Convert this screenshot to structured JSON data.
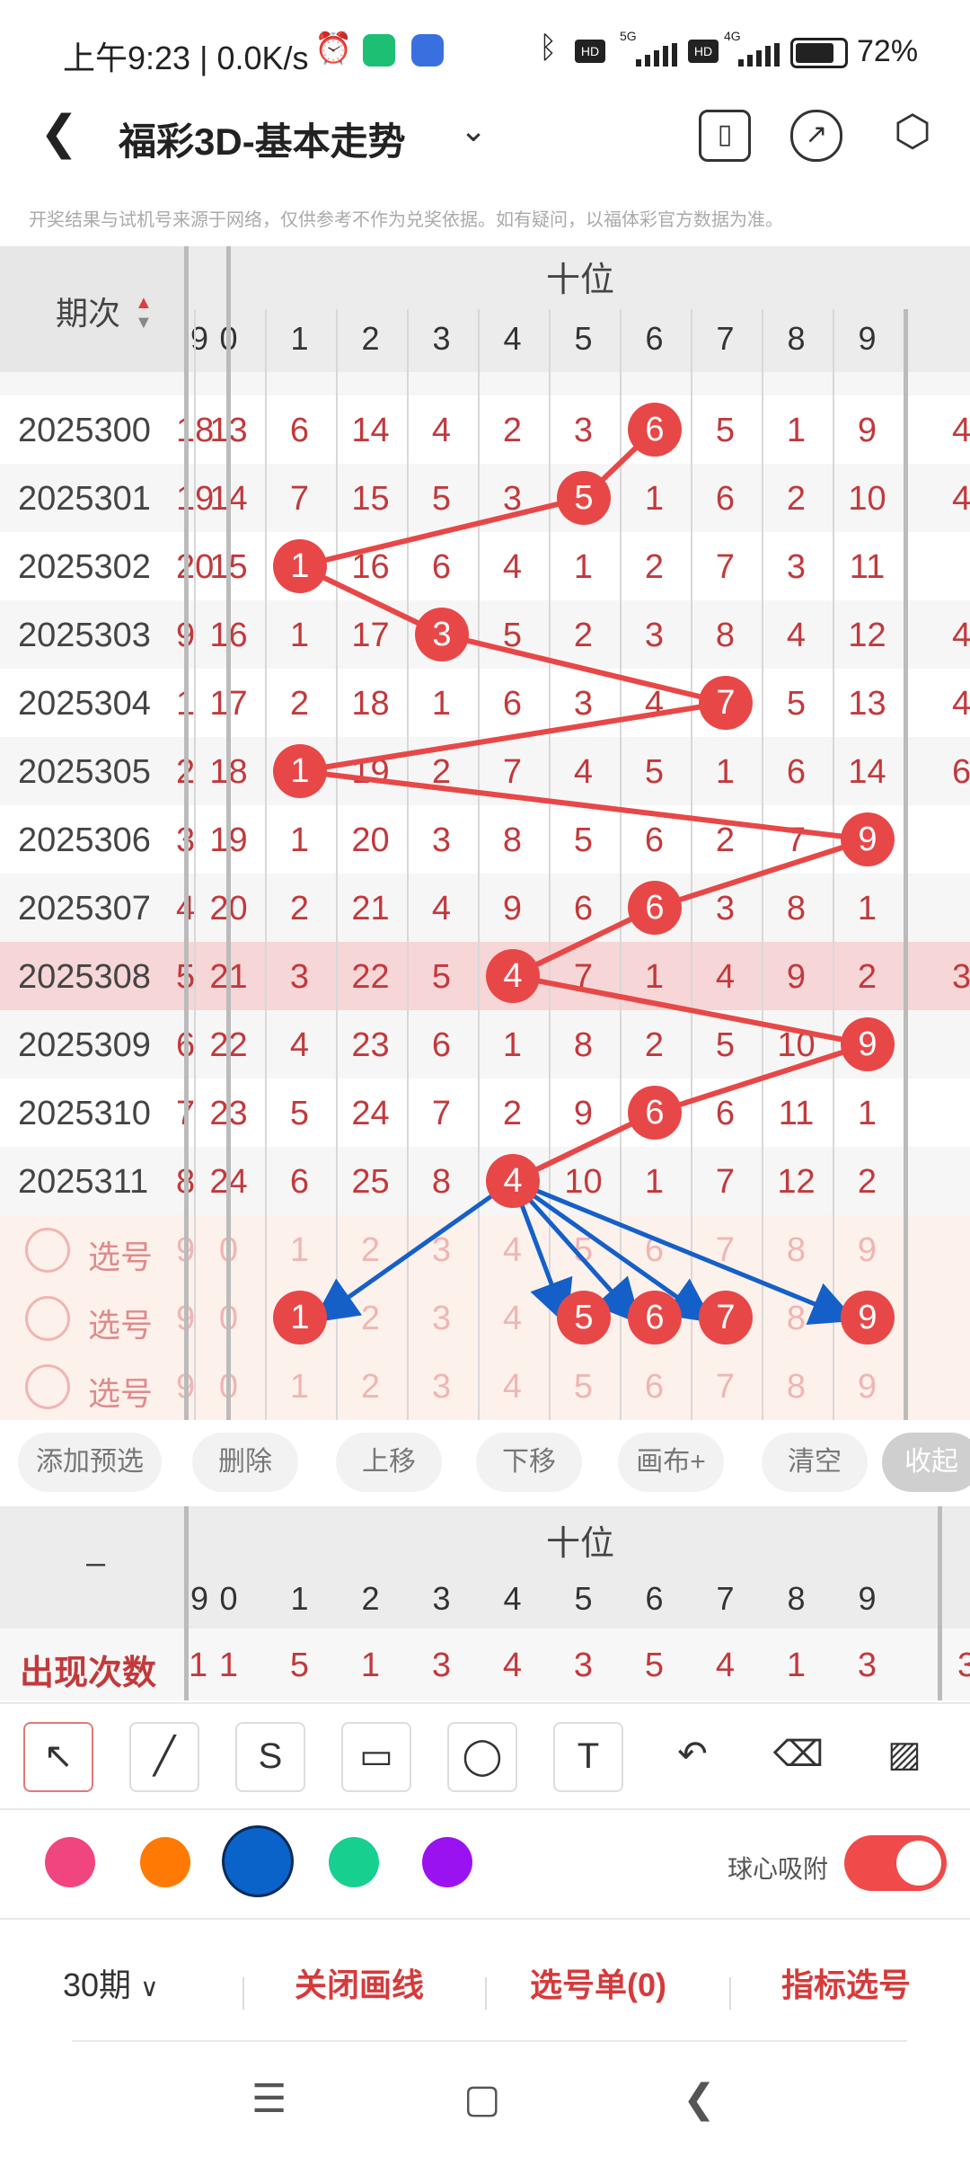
{
  "status_bar": {
    "time": "上午9:23",
    "speed": "| 0.0K/s",
    "icons": [
      "alarm-icon",
      "shield-app-icon",
      "baidu-app-icon",
      "bluetooth-icon",
      "hd-icon",
      "signal-5g-icon",
      "hd-icon",
      "signal-4g-icon",
      "battery-icon"
    ],
    "net_5g": "5G",
    "net_4g": "4G",
    "hd": "HD",
    "battery": "72%"
  },
  "header": {
    "title": "福彩3D-基本走势"
  },
  "disclaimer": "开奖结果与试机号来源于网络，仅供参考不作为兑奖依据。如有疑问，以福体彩官方数据为准。",
  "table": {
    "period_header": "期次",
    "section_header": "十位",
    "digit_headers": [
      "0",
      "1",
      "2",
      "3",
      "4",
      "5",
      "6",
      "7",
      "8",
      "9"
    ],
    "left_partial_header": "9",
    "rows": [
      {
        "period": "2025300",
        "left": "18",
        "cells": [
          "13",
          "6",
          "14",
          "4",
          "2",
          "3",
          "6",
          "5",
          "1",
          "9"
        ],
        "right": "4",
        "hit": 6
      },
      {
        "period": "2025301",
        "left": "19",
        "cells": [
          "14",
          "7",
          "15",
          "5",
          "3",
          "5",
          "1",
          "6",
          "2",
          "10"
        ],
        "right": "4",
        "hit": 5
      },
      {
        "period": "2025302",
        "left": "20",
        "cells": [
          "15",
          "1",
          "16",
          "6",
          "4",
          "1",
          "2",
          "7",
          "3",
          "11"
        ],
        "right": "",
        "hit": 1
      },
      {
        "period": "2025303",
        "left": "9",
        "cells": [
          "16",
          "1",
          "17",
          "3",
          "5",
          "2",
          "3",
          "8",
          "4",
          "12"
        ],
        "right": "4",
        "hit": 3
      },
      {
        "period": "2025304",
        "left": "1",
        "cells": [
          "17",
          "2",
          "18",
          "1",
          "6",
          "3",
          "4",
          "7",
          "5",
          "13"
        ],
        "right": "4",
        "hit": 7
      },
      {
        "period": "2025305",
        "left": "2",
        "cells": [
          "18",
          "1",
          "19",
          "2",
          "7",
          "4",
          "5",
          "1",
          "6",
          "14"
        ],
        "right": "6",
        "hit": 1
      },
      {
        "period": "2025306",
        "left": "3",
        "cells": [
          "19",
          "1",
          "20",
          "3",
          "8",
          "5",
          "6",
          "2",
          "7",
          "9"
        ],
        "right": "",
        "hit": 9
      },
      {
        "period": "2025307",
        "left": "4",
        "cells": [
          "20",
          "2",
          "21",
          "4",
          "9",
          "6",
          "6",
          "3",
          "8",
          "1"
        ],
        "right": "",
        "hit": 6
      },
      {
        "period": "2025308",
        "left": "5",
        "cells": [
          "21",
          "3",
          "22",
          "5",
          "4",
          "7",
          "1",
          "4",
          "9",
          "2"
        ],
        "right": "3",
        "hit": 4
      },
      {
        "period": "2025309",
        "left": "6",
        "cells": [
          "22",
          "4",
          "23",
          "6",
          "1",
          "8",
          "2",
          "5",
          "10",
          "9"
        ],
        "right": "",
        "hit": 9
      },
      {
        "period": "2025310",
        "left": "7",
        "cells": [
          "23",
          "5",
          "24",
          "7",
          "2",
          "9",
          "6",
          "6",
          "11",
          "1"
        ],
        "right": "",
        "hit": 6
      },
      {
        "period": "2025311",
        "left": "8",
        "cells": [
          "24",
          "6",
          "25",
          "8",
          "4",
          "10",
          "1",
          "7",
          "12",
          "2"
        ],
        "right": "",
        "hit": 4
      }
    ],
    "pick_rows": [
      {
        "label": "选号",
        "cells": [
          "0",
          "1",
          "2",
          "3",
          "4",
          "5",
          "6",
          "7",
          "8",
          "9"
        ],
        "left": "9",
        "balls": []
      },
      {
        "label": "选号",
        "cells": [
          "0",
          "1",
          "2",
          "3",
          "4",
          "5",
          "6",
          "7",
          "8",
          "9"
        ],
        "left": "9",
        "balls": [
          1,
          5,
          6,
          7,
          9
        ]
      },
      {
        "label": "选号",
        "cells": [
          "0",
          "1",
          "2",
          "3",
          "4",
          "5",
          "6",
          "7",
          "8",
          "9"
        ],
        "left": "9",
        "balls": []
      }
    ]
  },
  "actions": [
    "添加预选",
    "删除",
    "上移",
    "下移",
    "画布+",
    "清空",
    "收起"
  ],
  "stats": {
    "dash": "–",
    "section_header": "十位",
    "digit_headers": [
      "0",
      "1",
      "2",
      "3",
      "4",
      "5",
      "6",
      "7",
      "8",
      "9"
    ],
    "left_partial_header": "9",
    "label": "出现次数",
    "left": "1",
    "values": [
      "1",
      "5",
      "1",
      "3",
      "4",
      "3",
      "5",
      "4",
      "1",
      "3"
    ],
    "right": "3"
  },
  "tools": [
    "arrow-tool-icon",
    "line-tool-icon",
    "curve-tool-icon",
    "rectangle-tool-icon",
    "circle-tool-icon",
    "text-tool-icon",
    "undo-icon",
    "eraser-icon",
    "clear-brush-icon"
  ],
  "colors": [
    "#f0457f",
    "#ff7a05",
    "#0a63c9",
    "#17cf8f",
    "#9b12f0"
  ],
  "snap_label": "球心吸附",
  "bottom": {
    "period_select": "30期",
    "close_lines": "关闭画线",
    "pick_list": "选号单(0)",
    "indicator": "指标选号"
  }
}
